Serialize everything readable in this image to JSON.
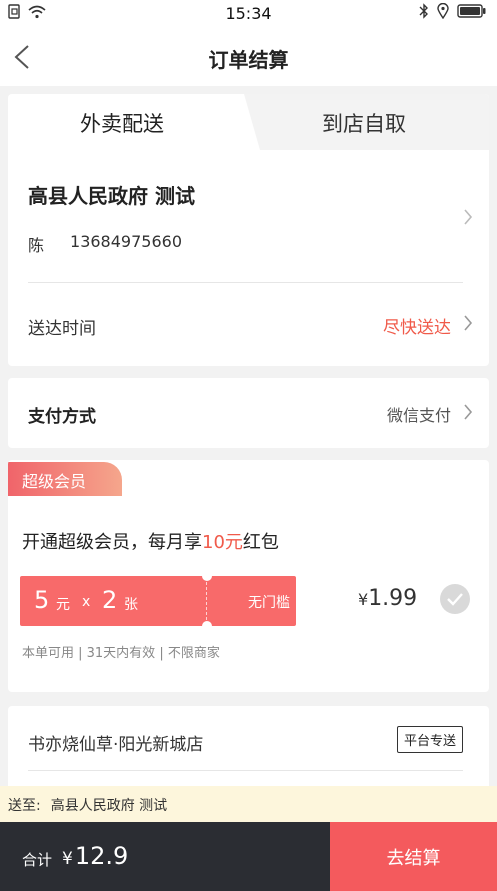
{
  "status_bar": {
    "time": "15:34"
  },
  "nav": {
    "title": "订单结算"
  },
  "tabs": [
    {
      "label": "外卖配送",
      "active": true
    },
    {
      "label": "到店自取",
      "active": false
    }
  ],
  "address": {
    "title": "高县人民政府 测试",
    "name": "陈",
    "phone": "13684975660"
  },
  "delivery_time": {
    "label": "送达时间",
    "value": "尽快送达"
  },
  "payment": {
    "label": "支付方式",
    "value": "微信支付"
  },
  "vip": {
    "badge": "超级会员",
    "headline_prefix": "开通超级会员，每月享",
    "headline_highlight": "10元",
    "headline_suffix": "红包",
    "coupon": {
      "amount": "5",
      "unit": "元",
      "mul": "x",
      "count": "2",
      "count_unit": "张",
      "tag": "无门槛"
    },
    "price_symbol": "¥",
    "price": "1.99",
    "note": "本单可用 | 31天内有效 | 不限商家"
  },
  "store": {
    "name": "书亦烧仙草·阳光新城店",
    "tag": "平台专送"
  },
  "send_to": {
    "label": "送至:",
    "value": "高县人民政府 测试"
  },
  "footer": {
    "total_label": "合计",
    "total_symbol": "¥",
    "total": "12.9",
    "checkout_label": "去结算"
  },
  "colors": {
    "accent": "#f05a4a",
    "dark": "#2b2d33",
    "checkout": "#f45a5d"
  }
}
